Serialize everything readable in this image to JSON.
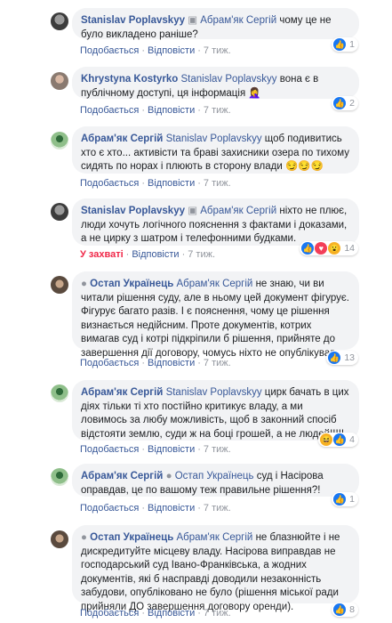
{
  "comments": [
    {
      "author": "Stanislav Poplavskyy",
      "mention": "Абрам'як Сергій",
      "text": "чому це не було викладено раніше?",
      "like_label": "Подобається",
      "reply_label": "Відповісти",
      "time": "7 тиж.",
      "reactions": [
        "like"
      ],
      "count": "1"
    },
    {
      "author": "Khrystyna Kostyrko",
      "mention": "Stanislav Poplavskyy",
      "text": "вона є в публічному доступі, ця інформація 🤦‍♀️",
      "like_label": "Подобається",
      "reply_label": "Відповісти",
      "time": "7 тиж.",
      "reactions": [
        "like"
      ],
      "count": "2"
    },
    {
      "author": "Абрам'як Сергій",
      "mention": "Stanislav Poplavskyy",
      "text": "щоб подивитись хто є хто... активісти та браві захисники озера по тихому сидять по норах і плюють в сторону влади 😏😏😏",
      "like_label": "Подобається",
      "reply_label": "Відповісти",
      "time": "7 тиж.",
      "reactions": [],
      "count": ""
    },
    {
      "author": "Stanislav Poplavskyy",
      "mention": "Абрам'як Сергій",
      "text": "ніхто не плює, люди хочуть логічного пояснення з фактами і доказами, а не цирку з шатром і телефонними будками.",
      "like_label": "У захваті",
      "reply_label": "Відповісти",
      "time": "7 тиж.",
      "reactions": [
        "like",
        "love",
        "wow"
      ],
      "count": "14"
    },
    {
      "author": "Остап Українець",
      "mention": "Абрам'як Сергій",
      "text": "не знаю, чи ви читали рішення суду, але в ньому цей документ фігурує. Фігурує багато разів. І є пояснення, чому це рішення визнається недійсним. Проте документів, котрих вимагав суд і котрі підкріпили б рішення, прийняте до завершення дії договору, чомусь ніхто не опублікував.",
      "like_label": "Подобається",
      "reply_label": "Відповісти",
      "time": "7 тиж.",
      "reactions": [
        "like"
      ],
      "count": "13"
    },
    {
      "author": "Абрам'як Сергій",
      "mention": "Stanislav Poplavskyy",
      "text": "цирк бачать в цих діях тільки ті хто постійно критикує владу, а ми ловимось за любу можливість, щоб в законний спосіб відстояти землю, суди ж на боці грошей, а не людей!!!!!",
      "like_label": "Подобається",
      "reply_label": "Відповісти",
      "time": "7 тиж.",
      "reactions": [
        "haha",
        "like"
      ],
      "count": "4"
    },
    {
      "author": "Абрам'як Сергій",
      "mention": "Остап Українець",
      "text": "суд і Насірова оправдав, це по вашому теж правильне рішення?!",
      "like_label": "Подобається",
      "reply_label": "Відповісти",
      "time": "7 тиж.",
      "reactions": [
        "like"
      ],
      "count": "1"
    },
    {
      "author": "Остап Українець",
      "mention": "Абрам'як Сергій",
      "text": "не блазнюйте і не дискредитуйте місцеву владу. Насірова виправдав не господарський суд Івано-Франківська, а жодних документів, які б насправді доводили незаконність забудови, опубліковано не було (рішення міської ради прийняли ДО завершення договору оренди).",
      "like_label": "Подобається",
      "reply_label": "Відповісти",
      "time": "7 тиж.",
      "reactions": [
        "like"
      ],
      "count": "8"
    }
  ]
}
